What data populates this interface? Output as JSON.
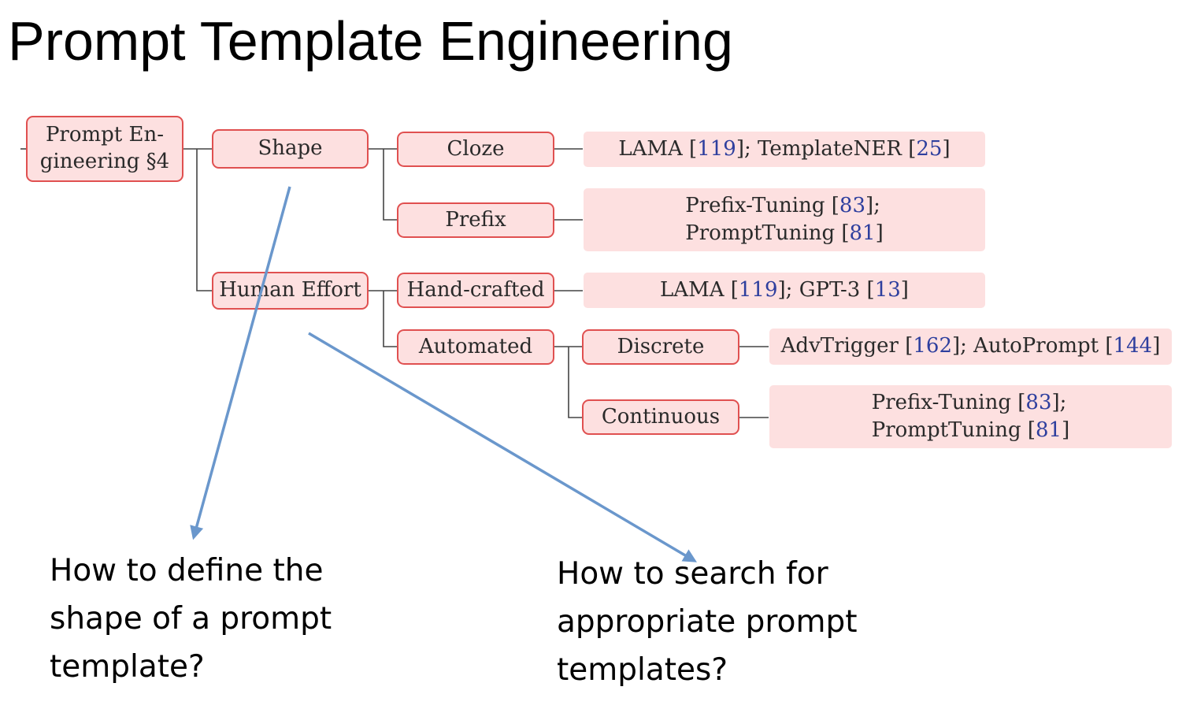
{
  "title": "Prompt Template Engineering",
  "tree": {
    "root": {
      "lines": [
        "Prompt En-",
        "gineering §4"
      ]
    },
    "shape": {
      "label": "Shape",
      "cloze": {
        "label": "Cloze",
        "refs": [
          [
            "LAMA [",
            "119",
            "]; TemplateNER [",
            "25",
            "]"
          ]
        ]
      },
      "prefix": {
        "label": "Prefix",
        "refs": [
          [
            "Prefix-Tuning [",
            "83",
            "];"
          ],
          [
            "PromptTuning [",
            "81",
            "]"
          ]
        ]
      }
    },
    "human_effort": {
      "label": "Human Effort",
      "hand_crafted": {
        "label": "Hand-crafted",
        "refs": [
          [
            "LAMA [",
            "119",
            "]; GPT-3 [",
            "13",
            "]"
          ]
        ]
      },
      "automated": {
        "label": "Automated",
        "discrete": {
          "label": "Discrete",
          "refs": [
            [
              "AdvTrigger [",
              "162",
              "]; AutoPrompt [",
              "144",
              "]"
            ]
          ]
        },
        "continuous": {
          "label": "Continuous",
          "refs": [
            [
              "Prefix-Tuning [",
              "83",
              "];"
            ],
            [
              "PromptTuning [",
              "81",
              "]"
            ]
          ]
        }
      }
    }
  },
  "questions": {
    "shape": [
      "How to define the",
      "shape of a prompt",
      "template?"
    ],
    "search": [
      "How to search for",
      "appropriate prompt",
      "templates?"
    ]
  },
  "colors": {
    "node_fill": "#fde0e0",
    "node_border": "#e05050",
    "leaf_fill": "#fde0e0",
    "reference_number": "#2e3f9e",
    "connector": "#444444",
    "arrow": "#6a97cc"
  }
}
